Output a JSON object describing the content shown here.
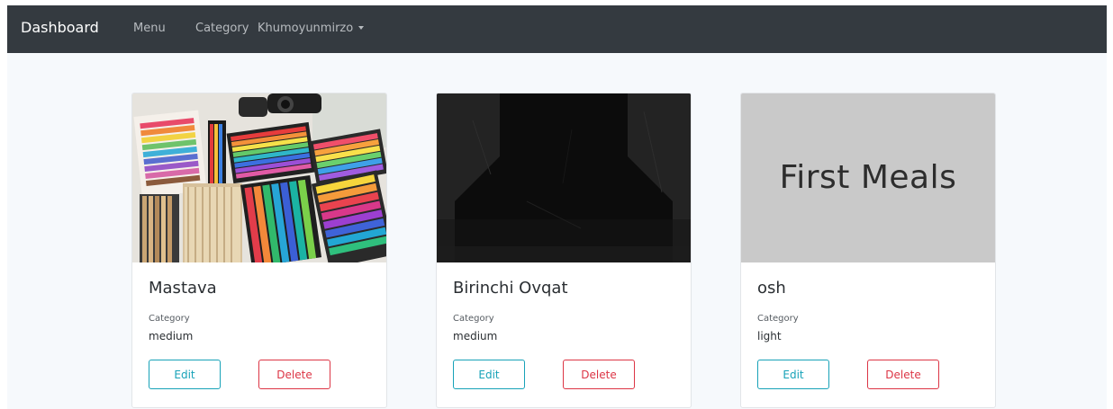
{
  "navbar": {
    "brand": "Dashboard",
    "links": [
      "Menu",
      "Category"
    ],
    "user_menu": "Khumoyunmirzo"
  },
  "cards": [
    {
      "title": "Mastava",
      "category_label": "Category",
      "category": "medium",
      "edit_label": "Edit",
      "delete_label": "Delete",
      "image": "colored-pencils-photo"
    },
    {
      "title": "Birinchi Ovqat",
      "category_label": "Category",
      "category": "medium",
      "edit_label": "Edit",
      "delete_label": "Delete",
      "image": "dark-abstract-photo"
    },
    {
      "title": "osh",
      "category_label": "Category",
      "category": "light",
      "edit_label": "Edit",
      "delete_label": "Delete",
      "image_text": "First Meals"
    }
  ],
  "colors": {
    "navbar_bg": "#343a40",
    "page_bg": "#f6f9fc",
    "edit": "#17a2b8",
    "delete": "#dc3545",
    "placeholder_bg": "#c9c9c9"
  }
}
